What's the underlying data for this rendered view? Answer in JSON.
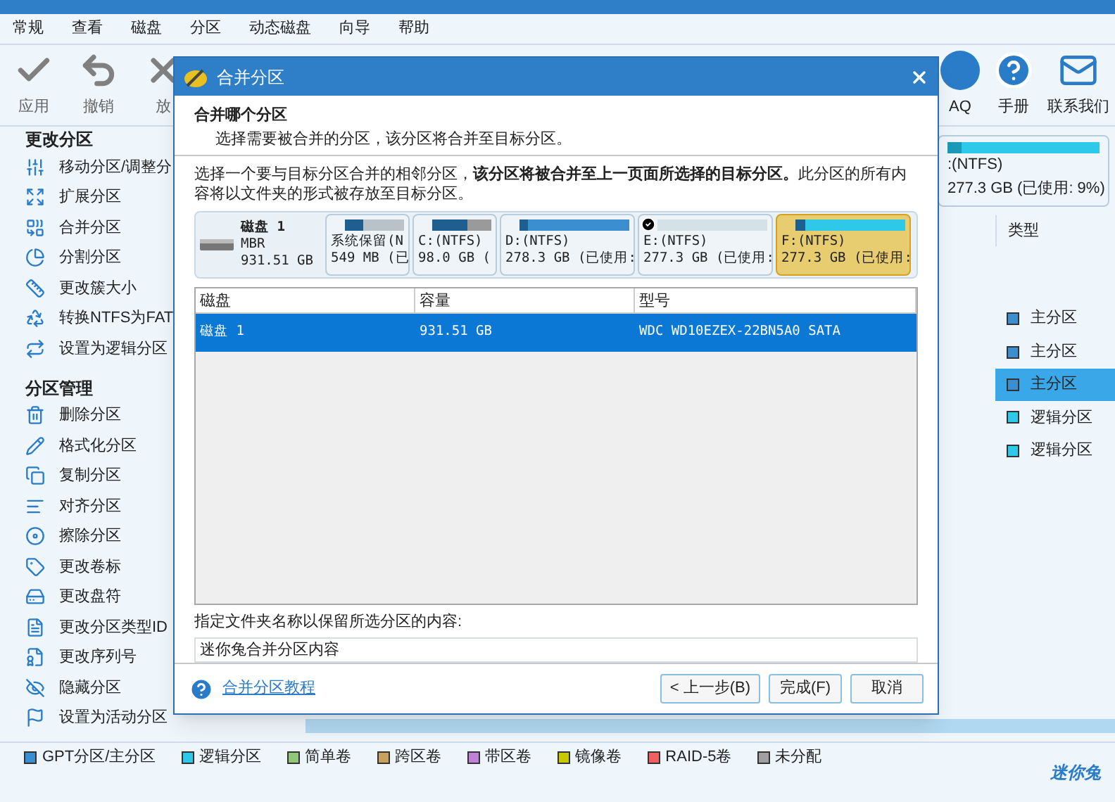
{
  "menu": [
    {
      "label": "常规"
    },
    {
      "label": "查看"
    },
    {
      "label": "磁盘"
    },
    {
      "label": "分区"
    },
    {
      "label": "动态磁盘"
    },
    {
      "label": "向导"
    },
    {
      "label": "帮助"
    }
  ],
  "toolbar": [
    {
      "label": "应用",
      "kind": "apply"
    },
    {
      "label": "撤销",
      "kind": "undo"
    },
    {
      "label": "放",
      "kind": "discard"
    }
  ],
  "toolbar_right": [
    {
      "label": "AQ",
      "kind": "faq"
    },
    {
      "label": "手册",
      "kind": "help"
    },
    {
      "label": "联系我们",
      "kind": "mail"
    }
  ],
  "sidebar": [
    {
      "title": "更改分区",
      "items": [
        {
          "label": "移动分区/调整分"
        },
        {
          "label": "扩展分区"
        },
        {
          "label": "合并分区"
        },
        {
          "label": "分割分区"
        },
        {
          "label": "更改簇大小"
        },
        {
          "label": "转换NTFS为FAT"
        },
        {
          "label": "设置为逻辑分区"
        }
      ]
    },
    {
      "title": "分区管理",
      "items": [
        {
          "label": "删除分区"
        },
        {
          "label": "格式化分区"
        },
        {
          "label": "复制分区"
        },
        {
          "label": "对齐分区"
        },
        {
          "label": "擦除分区"
        },
        {
          "label": "更改卷标"
        },
        {
          "label": "更改盘符"
        },
        {
          "label": "更改分区类型ID"
        },
        {
          "label": "更改序列号"
        },
        {
          "label": "隐藏分区"
        },
        {
          "label": "设置为活动分区"
        }
      ]
    }
  ],
  "disk_map": {
    "name": ":(NTFS)",
    "detail": "277.3 GB (已使用: 9%)",
    "level": 0.09
  },
  "partition_list": {
    "column": "类型",
    "rows": [
      {
        "type": "主分区",
        "color": "#3b8fd0",
        "selected": false
      },
      {
        "type": "主分区",
        "color": "#3b8fd0",
        "selected": false
      },
      {
        "type": "主分区",
        "color": "#3b8fd0",
        "selected": true
      },
      {
        "type": "逻辑分区",
        "color": "#2ec8e8",
        "selected": false
      },
      {
        "type": "逻辑分区",
        "color": "#2ec8e8",
        "selected": false
      }
    ]
  },
  "legend": [
    {
      "label": "GPT分区/主分区",
      "color": "#3b8fd0"
    },
    {
      "label": "逻辑分区",
      "color": "#2ec8e8"
    },
    {
      "label": "简单卷",
      "color": "#90c87a"
    },
    {
      "label": "跨区卷",
      "color": "#c8a060"
    },
    {
      "label": "带区卷",
      "color": "#c080d8"
    },
    {
      "label": "镜像卷",
      "color": "#c8c800"
    },
    {
      "label": "RAID-5卷",
      "color": "#f06060"
    },
    {
      "label": "未分配",
      "color": "#a0a0a0"
    }
  ],
  "dialog": {
    "title": "合并分区",
    "heading": "合并哪个分区",
    "subheading": "选择需要被合并的分区，该分区将合并至目标分区。",
    "instruction": "选择一个要与目标分区合并的相邻分区，**该分区将被合并至上一页面所选择的目标分区。**此分区的所有内容将以文件夹的形式被存放至目标分区。",
    "disk": {
      "name": "磁盘 1",
      "style": "MBR",
      "size": "931.51 GB"
    },
    "partitions": [
      {
        "name": "系统保留(N",
        "size": "549 MB (已",
        "color": "#b8c2c8",
        "level": 0.3,
        "checked": false,
        "selected": false
      },
      {
        "name": "C:(NTFS)",
        "size": "98.0 GB (",
        "color": "#9a9a9a",
        "level": 0.6,
        "checked": false,
        "selected": false
      },
      {
        "name": "D:(NTFS)",
        "size": "278.3 GB (已使用:",
        "color": "#3b8fd0",
        "level": 0.08,
        "checked": false,
        "selected": false
      },
      {
        "name": "E:(NTFS)",
        "size": "277.3 GB (已使用:",
        "color": "#d4e2e8",
        "checked": true,
        "selected": false
      },
      {
        "name": "F:(NTFS)",
        "size": "277.3 GB (已使用:",
        "color": "#2ec8e8",
        "level": 0.09,
        "checked": false,
        "selected": true
      }
    ],
    "table": {
      "columns": [
        "磁盘",
        "容量",
        "型号"
      ],
      "rows": [
        {
          "cells": [
            "磁盘 1",
            "931.51 GB",
            "WDC WD10EZEX-22BN5A0 SATA"
          ],
          "selected": true
        }
      ]
    },
    "folder_label": "指定文件夹名称以保留所选分区的内容:",
    "folder_value": "迷你兔合并分区内容",
    "help_link": "合并分区教程",
    "buttons": [
      {
        "label": "< 上一步(B)"
      },
      {
        "label": "完成(F)"
      },
      {
        "label": "取消"
      }
    ]
  },
  "logo": "迷你兔"
}
